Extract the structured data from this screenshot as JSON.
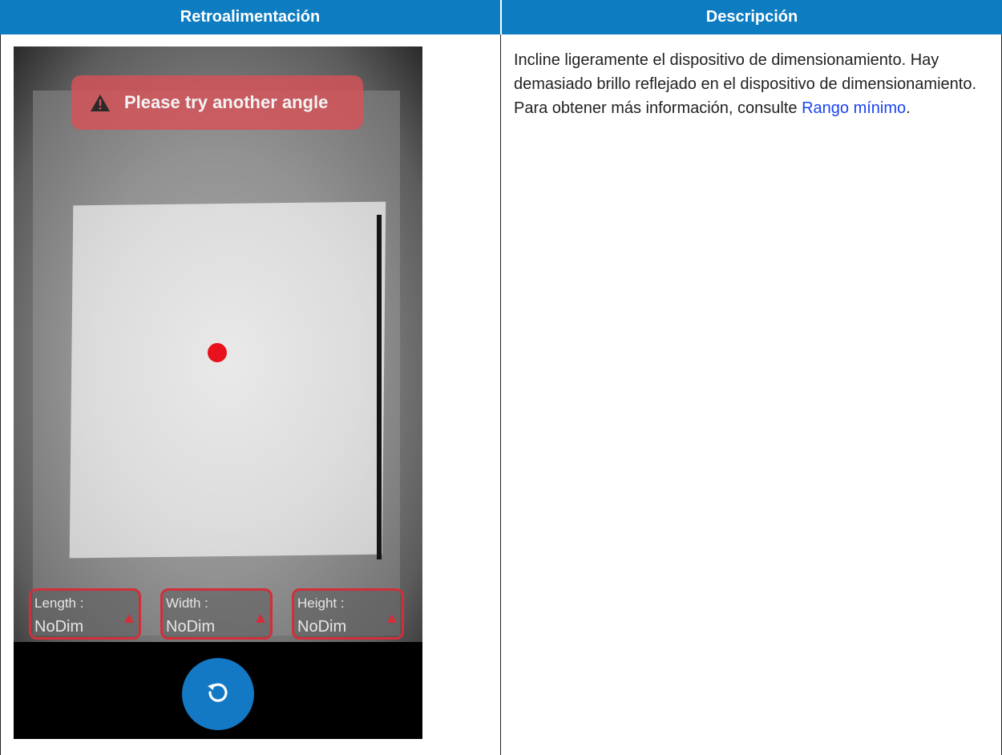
{
  "table": {
    "headers": [
      "Retroalimentación",
      "Descripción"
    ]
  },
  "phone": {
    "alert_text": "Please try another angle",
    "dimensions": [
      {
        "label": "Length :",
        "value": "NoDim"
      },
      {
        "label": "Width :",
        "value": "NoDim"
      },
      {
        "label": "Height :",
        "value": "NoDim"
      }
    ],
    "icons": {
      "alert": "warning-triangle-icon",
      "dimension_warning": "warning-triangle-icon",
      "refresh": "refresh-icon"
    },
    "colors": {
      "target_dot": "#e8121c",
      "alert_bg": "#d65258",
      "refresh_button": "#1479c4",
      "dimension_border": "#d22f3a"
    }
  },
  "description": {
    "text_before_link": "Incline ligeramente el dispositivo de dimensionamiento. Hay demasiado brillo reflejado en el dispositivo de dimensionamiento. Para obtener más información, consulte ",
    "link_text": "Rango mínimo",
    "text_after_link": "."
  },
  "colors": {
    "header_bg": "#0e7cc1",
    "link": "#1a43f0"
  }
}
